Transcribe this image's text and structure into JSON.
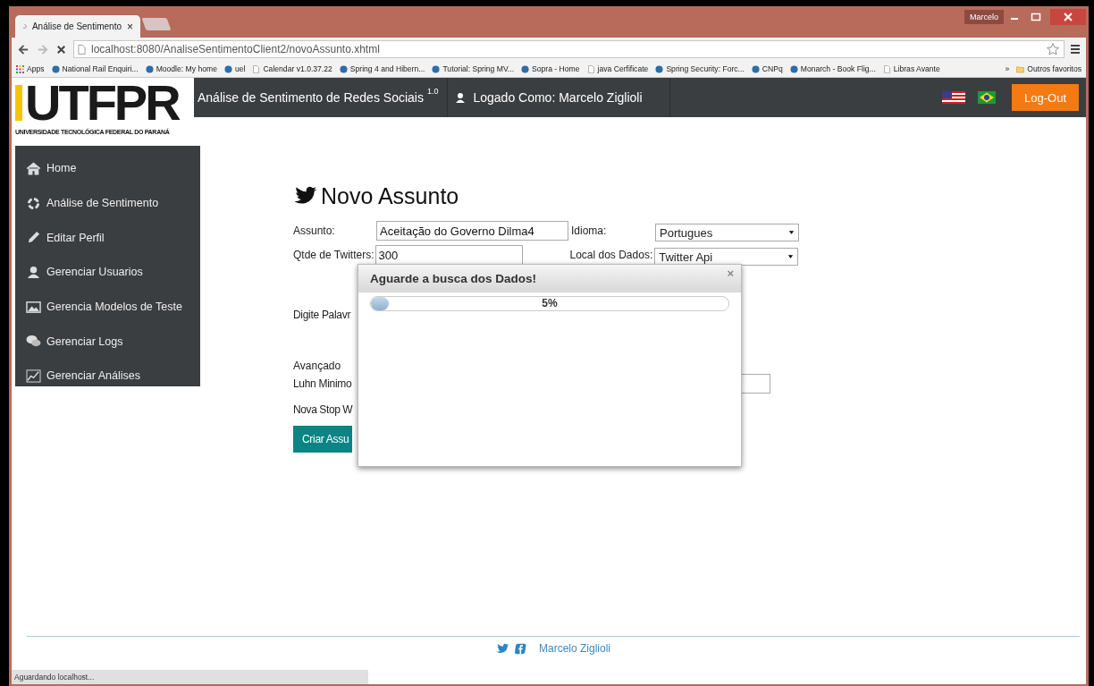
{
  "browser": {
    "tab": {
      "title": "Análise de Sentimento",
      "close": "×"
    },
    "profile": "Marcelo",
    "url": "localhost:8080/AnaliseSentimentoClient2/novoAssunto.xhtml",
    "bookmarks": [
      {
        "label": "Apps",
        "kind": "apps"
      },
      {
        "label": "National Rail Enquiri...",
        "kind": "site"
      },
      {
        "label": "Moodle: My home",
        "kind": "site"
      },
      {
        "label": "uel",
        "kind": "site"
      },
      {
        "label": "Calendar v1.0.37.22",
        "kind": "page"
      },
      {
        "label": "Spring 4 and Hibern...",
        "kind": "site"
      },
      {
        "label": "Tutorial: Spring MV...",
        "kind": "site"
      },
      {
        "label": "Sopra - Home",
        "kind": "site"
      },
      {
        "label": "java Cerfificate",
        "kind": "page"
      },
      {
        "label": "Spring Security: Forc...",
        "kind": "site"
      },
      {
        "label": "CNPq",
        "kind": "site"
      },
      {
        "label": "Monarch - Book Flig...",
        "kind": "site"
      },
      {
        "label": "Libras Avante",
        "kind": "page"
      }
    ],
    "more": "»",
    "other_bookmarks": "Outros favoritos",
    "status": "Aguardando localhost..."
  },
  "header": {
    "logo": "UTFPR",
    "logo_subtitle": "UNIVERSIDADE TECNOLÓGICA FEDERAL DO PARANÁ",
    "title": "Análise de Sentimento de Redes Sociais $^{1.0}$",
    "user": "Logado Como: Marcelo Ziglioli",
    "logout": "Log-Out"
  },
  "sidebar": {
    "items": [
      {
        "label": "Home"
      },
      {
        "label": "Análise de Sentimento"
      },
      {
        "label": "Editar Perfil"
      },
      {
        "label": "Gerenciar Usuarios"
      },
      {
        "label": "Gerencia Modelos de Teste"
      },
      {
        "label": "Gerenciar Logs"
      },
      {
        "label": "Gerenciar Análises"
      }
    ]
  },
  "form": {
    "title": "Novo Assunto",
    "subject_label": "Assunto:",
    "subject": "Aceitação do Governo Dilma4",
    "language_label": "Idioma:",
    "language": "Portugues",
    "count_label": "Qtde de Twitters:",
    "count": "300",
    "source_label": "Local dos Dados:",
    "source": "Twitter Api",
    "keywords_label": "Digite Palavr",
    "advanced_label": "Avançado",
    "luhn_label": "Luhn Minimo",
    "stopword_label": "Nova Stop W",
    "submit": "Criar Assu"
  },
  "dialog": {
    "title": "Aguarde a busca dos Dados!",
    "close": "×",
    "progress": {
      "level": 0.05,
      "reading": "5%"
    }
  },
  "footer": {
    "author": "Marcelo Ziglioli"
  }
}
